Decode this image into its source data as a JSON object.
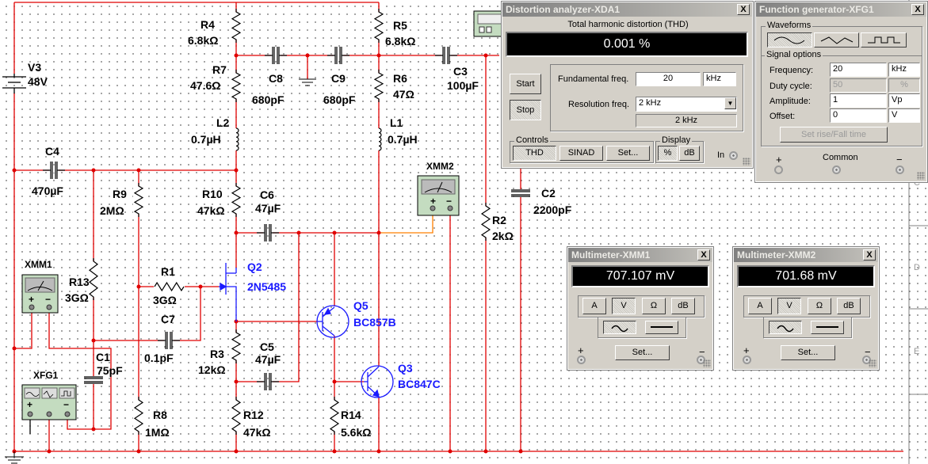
{
  "colors": {
    "wire": "#e00000",
    "component": "#000000",
    "transistor": "#1a1aff",
    "probe_wire": "#ff8000",
    "instrument_body": "#c4dcc0",
    "window_bg": "#d4d0c8",
    "display_bg": "#000000"
  },
  "components": {
    "V3": {
      "ref": "V3",
      "value": "48V"
    },
    "R4": {
      "ref": "R4",
      "value": "6.8kΩ"
    },
    "R5": {
      "ref": "R5",
      "value": "6.8kΩ"
    },
    "R7": {
      "ref": "R7",
      "value": "47.6Ω"
    },
    "R6": {
      "ref": "R6",
      "value": "47Ω"
    },
    "C8": {
      "ref": "C8",
      "value": "680pF"
    },
    "C9": {
      "ref": "C9",
      "value": "680pF"
    },
    "C3": {
      "ref": "C3",
      "value": "100µF"
    },
    "L2": {
      "ref": "L2",
      "value": "0.7µH"
    },
    "L1": {
      "ref": "L1",
      "value": "0.7µH"
    },
    "C4": {
      "ref": "C4",
      "value": "470µF"
    },
    "R9": {
      "ref": "R9",
      "value": "2MΩ"
    },
    "R10": {
      "ref": "R10",
      "value": "47kΩ"
    },
    "C6": {
      "ref": "C6",
      "value": "47µF"
    },
    "C2": {
      "ref": "C2",
      "value": "2200pF"
    },
    "R2": {
      "ref": "R2",
      "value": "2kΩ"
    },
    "R13": {
      "ref": "R13",
      "value": "3GΩ"
    },
    "R1": {
      "ref": "R1",
      "value": "3GΩ"
    },
    "C7": {
      "ref": "C7",
      "value": "0.1pF"
    },
    "C1": {
      "ref": "C1",
      "value": "75pF"
    },
    "R3": {
      "ref": "R3",
      "value": "12kΩ"
    },
    "C5": {
      "ref": "C5",
      "value": "47µF"
    },
    "R8": {
      "ref": "R8",
      "value": "1MΩ"
    },
    "R12": {
      "ref": "R12",
      "value": "47kΩ"
    },
    "R14": {
      "ref": "R14",
      "value": "5.6kΩ"
    },
    "Q2": {
      "ref": "Q2",
      "model": "2N5485"
    },
    "Q5": {
      "ref": "Q5",
      "model": "BC857B"
    },
    "Q3": {
      "ref": "Q3",
      "model": "BC847C"
    }
  },
  "instruments": {
    "XMM1": "XMM1",
    "XMM2": "XMM2",
    "XFG1": "XFG1",
    "xmm_plus": "+",
    "xmm_minus": "−"
  },
  "sheet_border": {
    "rows": [
      "C",
      "D",
      "E"
    ]
  },
  "distortion_analyzer": {
    "title": "Distortion analyzer-XDA1",
    "close": "X",
    "thd_label": "Total harmonic distortion (THD)",
    "readout": "0.001 %",
    "start": "Start",
    "stop": "Stop",
    "fundamental_label": "Fundamental freq.",
    "fundamental_value": "20",
    "fundamental_unit": "kHz",
    "resolution_label": "Resolution freq.",
    "resolution_value": "2 kHz",
    "resolution_display": "2 kHz",
    "controls_label": "Controls",
    "thd": "THD",
    "sinad": "SINAD",
    "set": "Set...",
    "display_label": "Display",
    "percent": "%",
    "db": "dB",
    "in_label": "In",
    "active_control": "THD",
    "active_display": "%"
  },
  "function_generator": {
    "title": "Function generator-XFG1",
    "close": "X",
    "waveforms_label": "Waveforms",
    "waveforms": [
      "sine-wave-icon",
      "triangle-wave-icon",
      "square-wave-icon"
    ],
    "selected_waveform": "sine",
    "signal_options_label": "Signal options",
    "frequency": {
      "label": "Frequency:",
      "value": "20",
      "unit": "kHz"
    },
    "duty_cycle": {
      "label": "Duty cycle:",
      "value": "50",
      "unit": "%"
    },
    "amplitude": {
      "label": "Amplitude:",
      "value": "1",
      "unit": "Vp"
    },
    "offset": {
      "label": "Offset:",
      "value": "0",
      "unit": "V"
    },
    "set_rise_fall": "Set rise/Fall time",
    "plus": "+",
    "common": "Common",
    "minus": "−"
  },
  "multimeters": [
    {
      "title": "Multimeter-XMM1",
      "close": "X",
      "readout": "707.107 mV",
      "buttons": [
        "A",
        "V",
        "Ω",
        "dB"
      ],
      "active": "V",
      "mode": "AC",
      "set": "Set...",
      "plus": "+",
      "minus": "−"
    },
    {
      "title": "Multimeter-XMM2",
      "close": "X",
      "readout": "701.68 mV",
      "buttons": [
        "A",
        "V",
        "Ω",
        "dB"
      ],
      "active": "V",
      "mode": "AC",
      "set": "Set...",
      "plus": "+",
      "minus": "−"
    }
  ]
}
